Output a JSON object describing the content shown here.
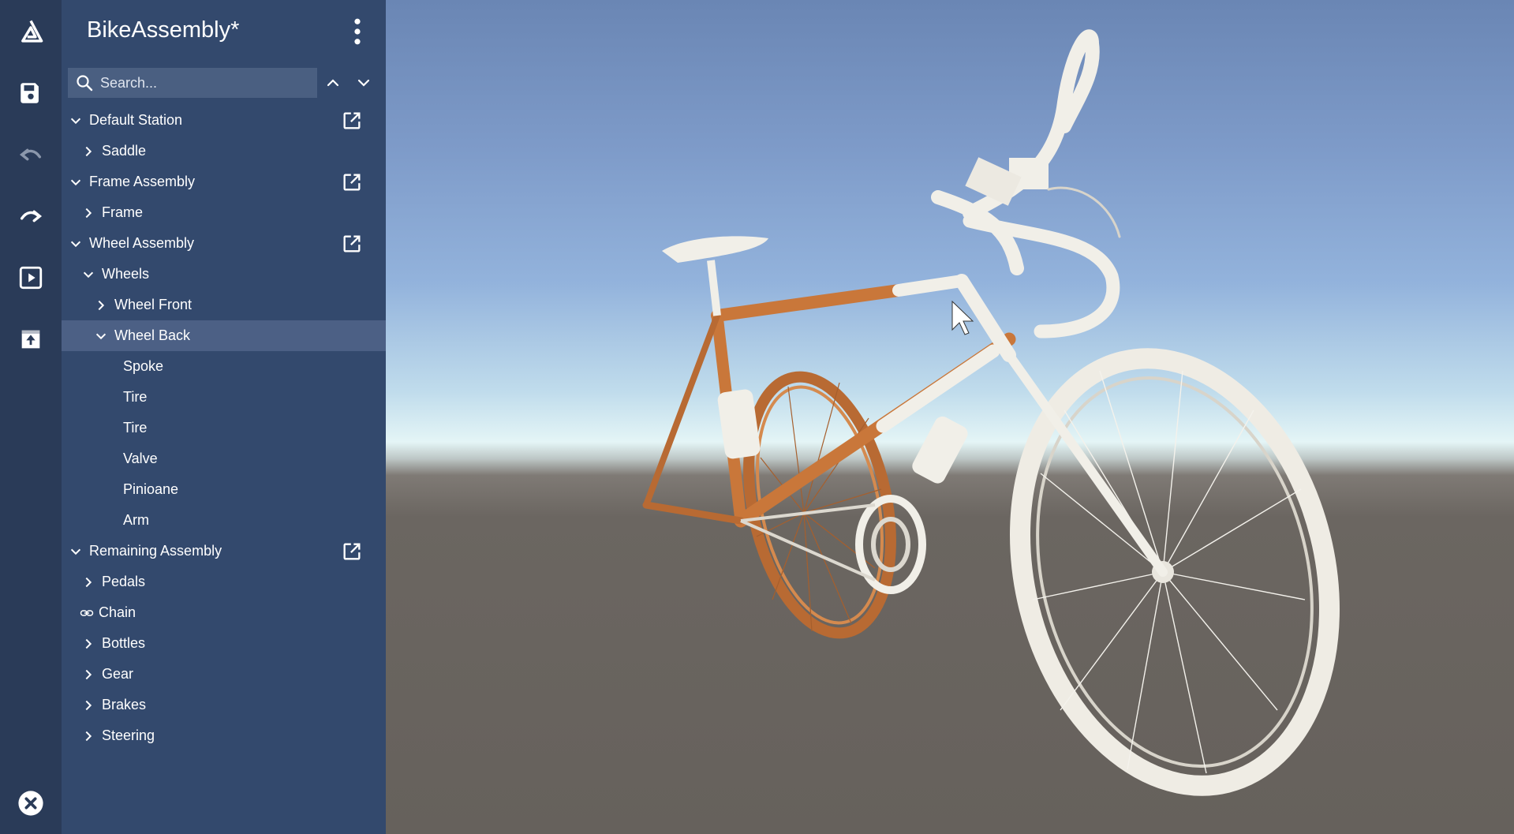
{
  "app": {
    "title": "BikeAssembly*"
  },
  "rail": {
    "icons": [
      "logo-icon",
      "save-icon",
      "undo-icon",
      "redo-icon",
      "play-icon",
      "upload-icon",
      "close-icon"
    ]
  },
  "search": {
    "placeholder": "Search..."
  },
  "tree": {
    "items": [
      {
        "label": "Default Station",
        "state": "expanded",
        "external_link": true
      },
      {
        "label": "Saddle",
        "state": "collapsed"
      },
      {
        "label": "Frame Assembly",
        "state": "expanded",
        "external_link": true
      },
      {
        "label": "Frame",
        "state": "collapsed"
      },
      {
        "label": "Wheel Assembly",
        "state": "expanded",
        "external_link": true
      },
      {
        "label": "Wheels",
        "state": "expanded"
      },
      {
        "label": "Wheel Front",
        "state": "collapsed"
      },
      {
        "label": "Wheel Back",
        "state": "expanded",
        "selected": true
      },
      {
        "label": "Spoke",
        "state": "leaf"
      },
      {
        "label": "Tire",
        "state": "leaf"
      },
      {
        "label": "Tire",
        "state": "leaf"
      },
      {
        "label": "Valve",
        "state": "leaf"
      },
      {
        "label": "Pinioane",
        "state": "leaf"
      },
      {
        "label": "Arm",
        "state": "leaf"
      },
      {
        "label": "Remaining Assembly",
        "state": "expanded",
        "external_link": true
      },
      {
        "label": "Pedals",
        "state": "collapsed"
      },
      {
        "label": "Chain",
        "state": "link"
      },
      {
        "label": "Bottles",
        "state": "collapsed"
      },
      {
        "label": "Gear",
        "state": "collapsed"
      },
      {
        "label": "Brakes",
        "state": "collapsed"
      },
      {
        "label": "Steering",
        "state": "collapsed"
      }
    ]
  },
  "colors": {
    "rail_bg": "#2a3b58",
    "panel_bg": "#33496d",
    "selected_row": "#4c6085",
    "frame_accent": "#c9773a",
    "bike_white": "#f1efe8"
  }
}
